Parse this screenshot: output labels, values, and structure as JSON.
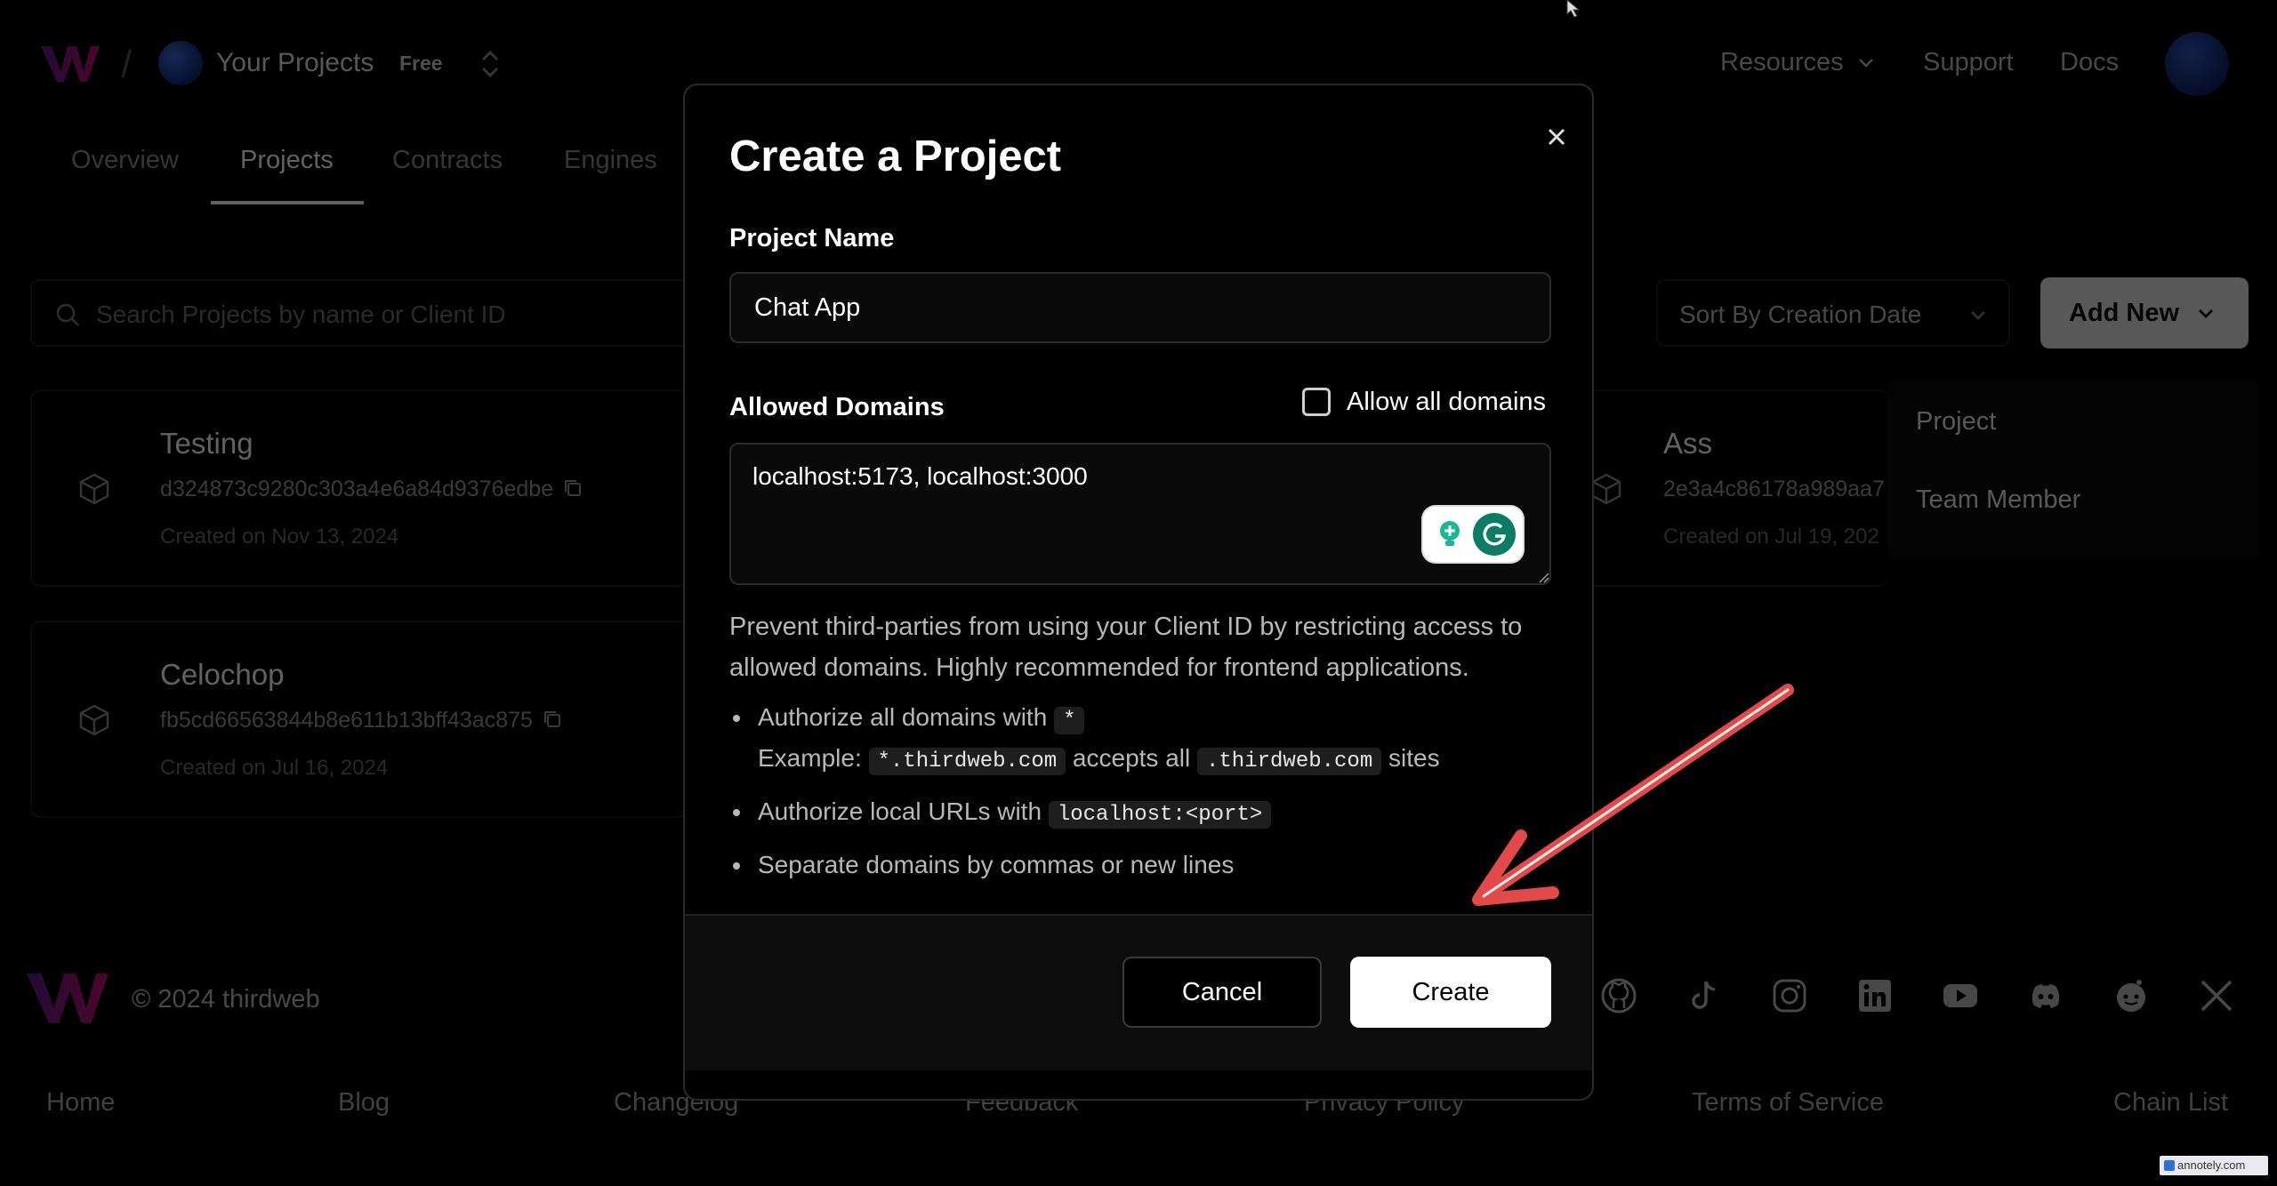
{
  "colors": {
    "accent": "#ffffff",
    "arrow": "#e24a4a",
    "logo_start": "#5b1f8f",
    "logo_end": "#c4126a"
  },
  "header": {
    "project_name": "Your Projects",
    "plan": "Free",
    "nav": {
      "resources": "Resources",
      "support": "Support",
      "docs": "Docs"
    }
  },
  "tabs": {
    "overview": "Overview",
    "projects": "Projects",
    "contracts": "Contracts",
    "engines": "Engines"
  },
  "toolbar": {
    "search_placeholder": "Search Projects by name or Client ID",
    "sort_label": "Sort By Creation Date",
    "add_new_label": "Add New",
    "add_new_menu": [
      "Project",
      "Team Member"
    ]
  },
  "projects": [
    {
      "name": "Testing",
      "client_id": "d324873c9280c303a4e6a84d9376edbe",
      "created": "Created on Nov 13, 2024"
    },
    {
      "name": "Celochop",
      "client_id": "fb5cd66563844b8e611b13bff43ac875",
      "created": "Created on Jul 16, 2024"
    },
    {
      "name": "Ass",
      "client_id": "2e3a4c86178a989aa7",
      "created": "Created on Jul 19, 202"
    }
  ],
  "footer": {
    "copyright": "© 2024 thirdweb",
    "links": [
      "Home",
      "Blog",
      "Changelog",
      "Feedback",
      "Privacy Policy",
      "Terms of Service",
      "Chain List"
    ],
    "social_icons": [
      "github-icon",
      "tiktok-icon",
      "instagram-icon",
      "linkedin-icon",
      "youtube-icon",
      "discord-icon",
      "reddit-icon",
      "x-icon"
    ]
  },
  "modal": {
    "title": "Create a Project",
    "project_name_label": "Project Name",
    "project_name_value": "Chat App",
    "allowed_domains_label": "Allowed Domains",
    "allow_all_label": "Allow all domains",
    "allow_all_checked": false,
    "domains_value": "localhost:5173, localhost:3000",
    "help_text": "Prevent third-parties from using your Client ID by restricting access to allowed domains. Highly recommended for frontend applications.",
    "bullets": {
      "b1_text": "Authorize all domains with",
      "b1_code": "*",
      "b1_example": "Example:",
      "b1_example_code": "*.thirdweb.com",
      "b1_accepts": "accepts all",
      "b1_accepts_code": ".thirdweb.com",
      "b1_sites": "sites",
      "b2_text": "Authorize local URLs with",
      "b2_code": "localhost:<port>",
      "b3_text": "Separate domains by commas or new lines"
    },
    "cancel_label": "Cancel",
    "create_label": "Create"
  },
  "watermark": "annotely.com"
}
